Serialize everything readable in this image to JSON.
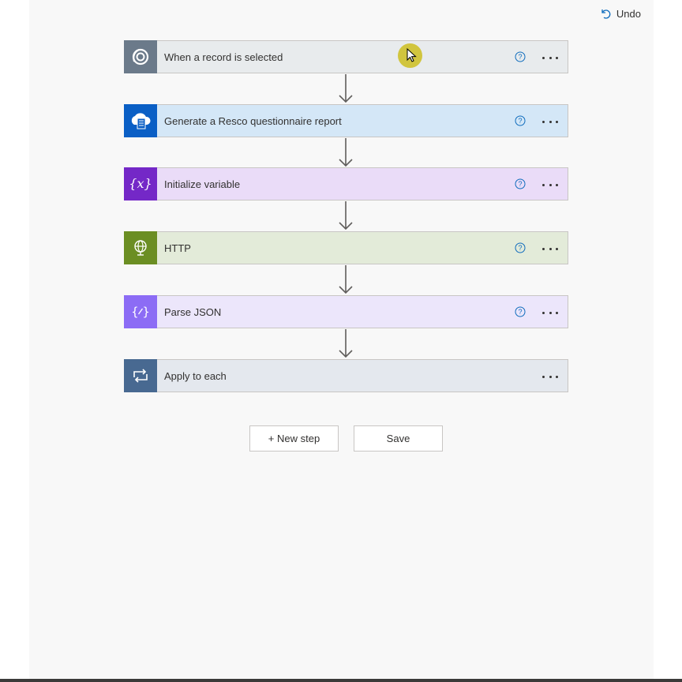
{
  "header": {
    "undo_label": "Undo",
    "undo_icon": "undo-icon"
  },
  "steps": [
    {
      "title": "When a record is selected",
      "icon": "dataverse-icon",
      "icon_bg": "#6b7a8a",
      "bg": "#e8ebed",
      "has_help": true
    },
    {
      "title": "Generate a Resco questionnaire report",
      "icon": "resco-cloud-icon",
      "icon_bg": "#0a5fc5",
      "bg": "#d4e7f7",
      "has_help": true
    },
    {
      "title": "Initialize variable",
      "icon": "variable-icon",
      "icon_bg": "#7428c7",
      "bg": "#eadcf8",
      "has_help": true
    },
    {
      "title": "HTTP",
      "icon": "globe-icon",
      "icon_bg": "#6b8e23",
      "bg": "#e3ebd9",
      "has_help": true
    },
    {
      "title": "Parse JSON",
      "icon": "parse-json-icon",
      "icon_bg": "#8c6cf5",
      "bg": "#ece6fb",
      "has_help": true
    },
    {
      "title": "Apply to each",
      "icon": "loop-icon",
      "icon_bg": "#486991",
      "bg": "#e4e8ee",
      "has_help": false
    }
  ],
  "actions": {
    "new_step_label": "+ New step",
    "save_label": "Save"
  },
  "colors": {
    "help_icon": "#0f6cbd",
    "connector": "#605e5c",
    "cursor_highlight": "#cdbe1e"
  }
}
